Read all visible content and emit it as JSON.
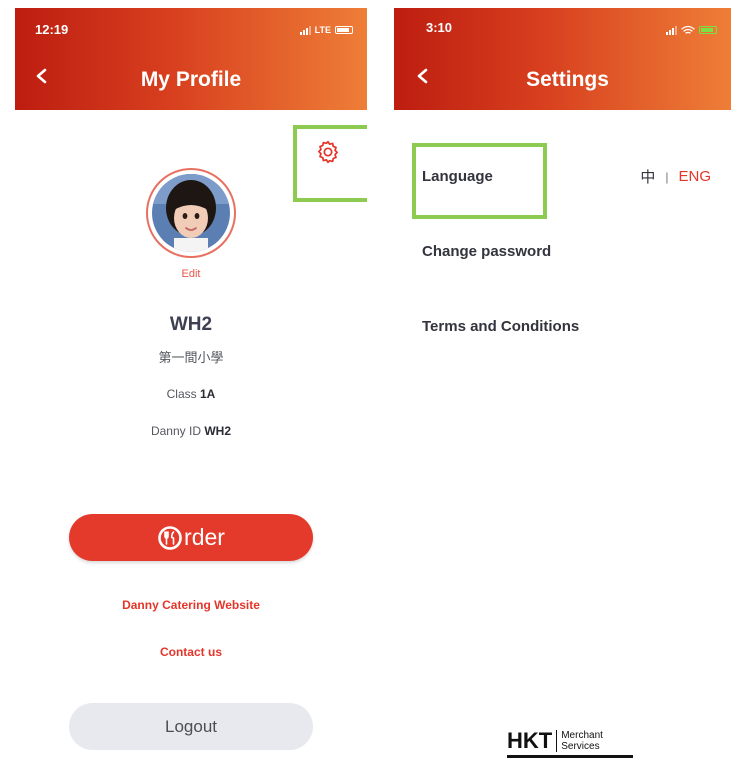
{
  "profile_screen": {
    "status_time": "12:19",
    "network": "LTE",
    "title": "My Profile",
    "edit_label": "Edit",
    "name": "WH2",
    "school": "第一間小學",
    "class_label": "Class",
    "class_value": "1A",
    "id_label": "Danny ID",
    "id_value": "WH2",
    "order_label": "rder",
    "website_link": "Danny Catering Website",
    "contact_link": "Contact us",
    "logout_label": "Logout"
  },
  "settings_screen": {
    "status_time": "3:10",
    "title": "Settings",
    "items": [
      {
        "label": "Language"
      },
      {
        "label": "Change password"
      },
      {
        "label": "Terms and Conditions"
      }
    ],
    "language_options": {
      "zh": "中",
      "separator": "|",
      "en": "ENG",
      "active": "ENG"
    }
  },
  "footer_logo": {
    "mark": "HKT",
    "line1": "Merchant",
    "line2": "Services"
  },
  "colors": {
    "accent": "#e4352a",
    "header_start": "#bd1d10",
    "header_end": "#ee7e37",
    "highlight": "#8ccb4f",
    "logout_bg": "#e8e9ee"
  },
  "icons": [
    "back-arrow-icon",
    "gear-icon",
    "cellular-signal-icon",
    "battery-icon",
    "location-arrow-icon",
    "wifi-icon",
    "order-fork-knife-icon"
  ]
}
